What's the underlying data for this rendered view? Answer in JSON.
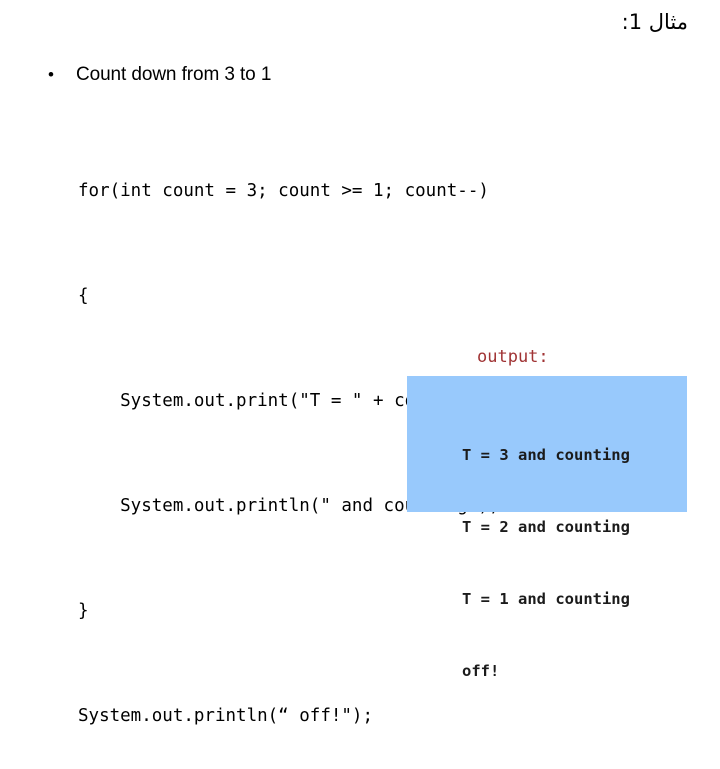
{
  "slide": {
    "title": "مثال 1:",
    "bullet": {
      "marker": "•",
      "text": "Count down from 3 to 1"
    },
    "code": {
      "lines": [
        "for(int count = 3; count >= 1; count--)",
        "{",
        "    System.out.print(\"T = \" + count);",
        "    System.out.println(\" and counting\");",
        "}",
        "System.out.println(“ off!\");"
      ]
    },
    "output": {
      "label": "output:",
      "box_color": "#98C9FC",
      "label_color": "#A03334",
      "lines": [
        "T = 3 and counting",
        "T = 2 and counting",
        "T = 1 and counting",
        "off!"
      ]
    }
  }
}
